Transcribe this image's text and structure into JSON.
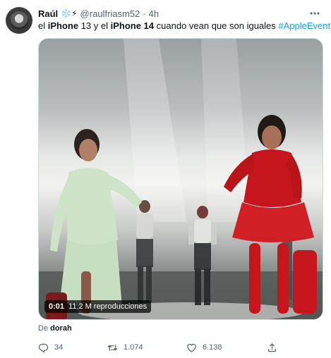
{
  "tweet": {
    "author_name": "Raúl",
    "author_emoji": "❄️⚡",
    "handle": "@raulfriasm52",
    "separator": "·",
    "time": "4h",
    "more_icon": "more-icon",
    "text": {
      "part1": "el ",
      "iphone13": "iPhone",
      "part2": " 13 y el ",
      "iphone14": "iPhone 14",
      "part3": " cuando vean que son iguales ",
      "hashtag": "#AppleEvent"
    },
    "video": {
      "time": "0:01",
      "views": "11,2 M reproducciones"
    },
    "source": {
      "prefix": "De ",
      "name": "dorah"
    },
    "actions": {
      "reply_count": "34",
      "retweet_count": "1.074",
      "like_count": "6.138",
      "reply_icon": "reply-icon",
      "retweet_icon": "retweet-icon",
      "like_icon": "heart-icon",
      "share_icon": "share-icon"
    }
  },
  "colors": {
    "link": "#1d9bf0",
    "muted": "#536471",
    "text": "#0f1419",
    "left_outfit": "#cfe3c8",
    "right_outfit": "#c4161c"
  }
}
